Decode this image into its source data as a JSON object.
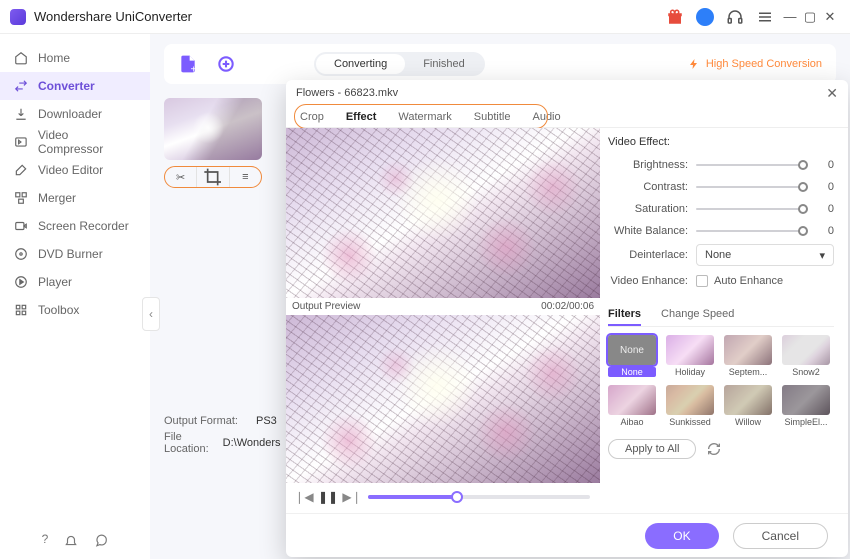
{
  "app": {
    "title": "Wondershare UniConverter"
  },
  "window": {
    "min": "—",
    "max": "▢",
    "close": "✕"
  },
  "sidebar": {
    "items": [
      {
        "label": "Home"
      },
      {
        "label": "Converter"
      },
      {
        "label": "Downloader"
      },
      {
        "label": "Video Compressor"
      },
      {
        "label": "Video Editor"
      },
      {
        "label": "Merger"
      },
      {
        "label": "Screen Recorder"
      },
      {
        "label": "DVD Burner"
      },
      {
        "label": "Player"
      },
      {
        "label": "Toolbox"
      }
    ]
  },
  "toolbar": {
    "tabs": {
      "converting": "Converting",
      "finished": "Finished"
    },
    "hsc": "High Speed Conversion"
  },
  "footer": {
    "outfmt_label": "Output Format:",
    "outfmt_value": "PS3",
    "loc_label": "File Location:",
    "loc_value": "D:\\Wonders"
  },
  "dialog": {
    "title": "Flowers - 66823.mkv",
    "tabs": {
      "crop": "Crop",
      "effect": "Effect",
      "watermark": "Watermark",
      "subtitle": "Subtitle",
      "audio": "Audio"
    },
    "preview_label": "Output Preview",
    "time": "00:02/00:06",
    "effect_title": "Video Effect:",
    "sliders": {
      "brightness": {
        "label": "Brightness:",
        "value": "0"
      },
      "contrast": {
        "label": "Contrast:",
        "value": "0"
      },
      "saturation": {
        "label": "Saturation:",
        "value": "0"
      },
      "whitebal": {
        "label": "White Balance:",
        "value": "0"
      }
    },
    "deinterlace": {
      "label": "Deinterlace:",
      "value": "None",
      "caret": "▾"
    },
    "enhance": {
      "label": "Video Enhance:",
      "checkbox": "Auto Enhance"
    },
    "subtabs": {
      "filters": "Filters",
      "speed": "Change Speed"
    },
    "filters": [
      {
        "name": "None"
      },
      {
        "name": "Holiday"
      },
      {
        "name": "Septem..."
      },
      {
        "name": "Snow2"
      },
      {
        "name": "Aibao"
      },
      {
        "name": "Sunkissed"
      },
      {
        "name": "Willow"
      },
      {
        "name": "SimpleEl..."
      }
    ],
    "apply_all": "Apply to All",
    "ok": "OK",
    "cancel": "Cancel"
  }
}
